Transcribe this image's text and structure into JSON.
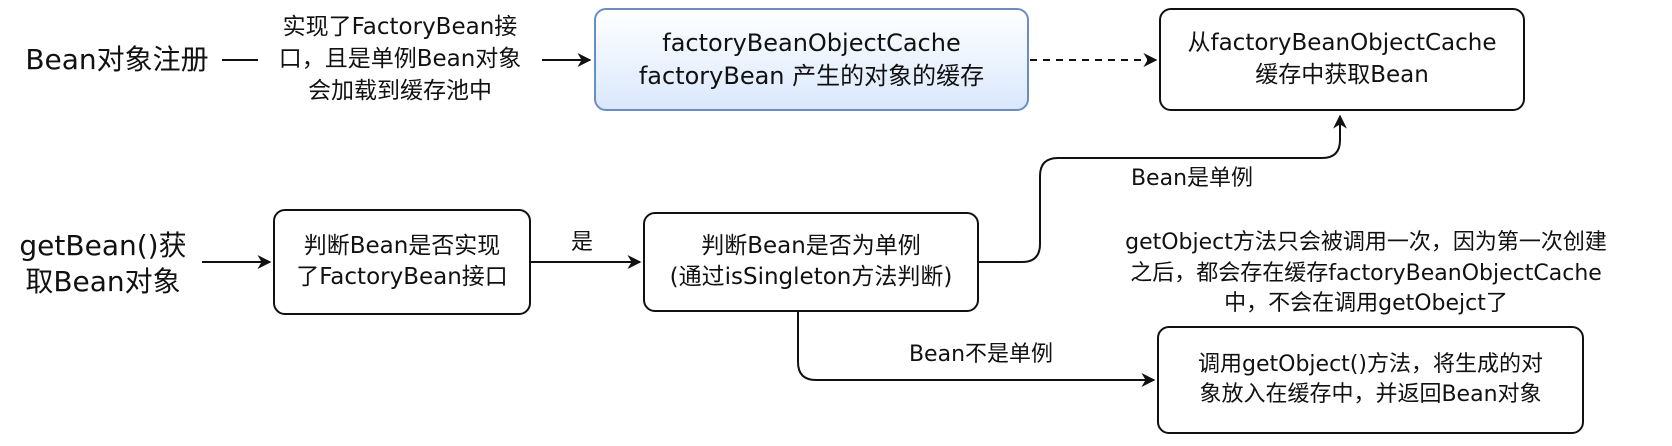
{
  "left_labels": {
    "register": "Bean对象注册",
    "get_bean": "getBean()获\n取Bean对象"
  },
  "edge_labels": {
    "register_note": "实现了FactoryBean接\n口，且是单例Bean对象\n会加载到缓存池中",
    "is_yes": "是",
    "singleton": "Bean是单例",
    "not_singleton": "Bean不是单例",
    "cache_note": "getObject方法只会被调用一次，因为第一次创建\n之后，都会存在缓存factoryBeanObjectCache\n中，不会在调用getObejct了"
  },
  "nodes": {
    "cache": "factoryBeanObjectCache\nfactoryBean 产生的对象的缓存",
    "get_from_cache": "从factoryBeanObjectCache\n缓存中获取Bean",
    "check_impl": "判断Bean是否实现\n了FactoryBean接口",
    "check_singleton": "判断Bean是否为单例\n(通过isSingleton方法判断)",
    "call_get_object": "调用getObject()方法，将生成的对\n象放入在缓存中，并返回Bean对象"
  },
  "colors": {
    "stroke": "#111111",
    "cache_fill_top": "#ffffff",
    "cache_fill_bottom": "#dae8fc",
    "cache_border": "#6c8ebf"
  }
}
